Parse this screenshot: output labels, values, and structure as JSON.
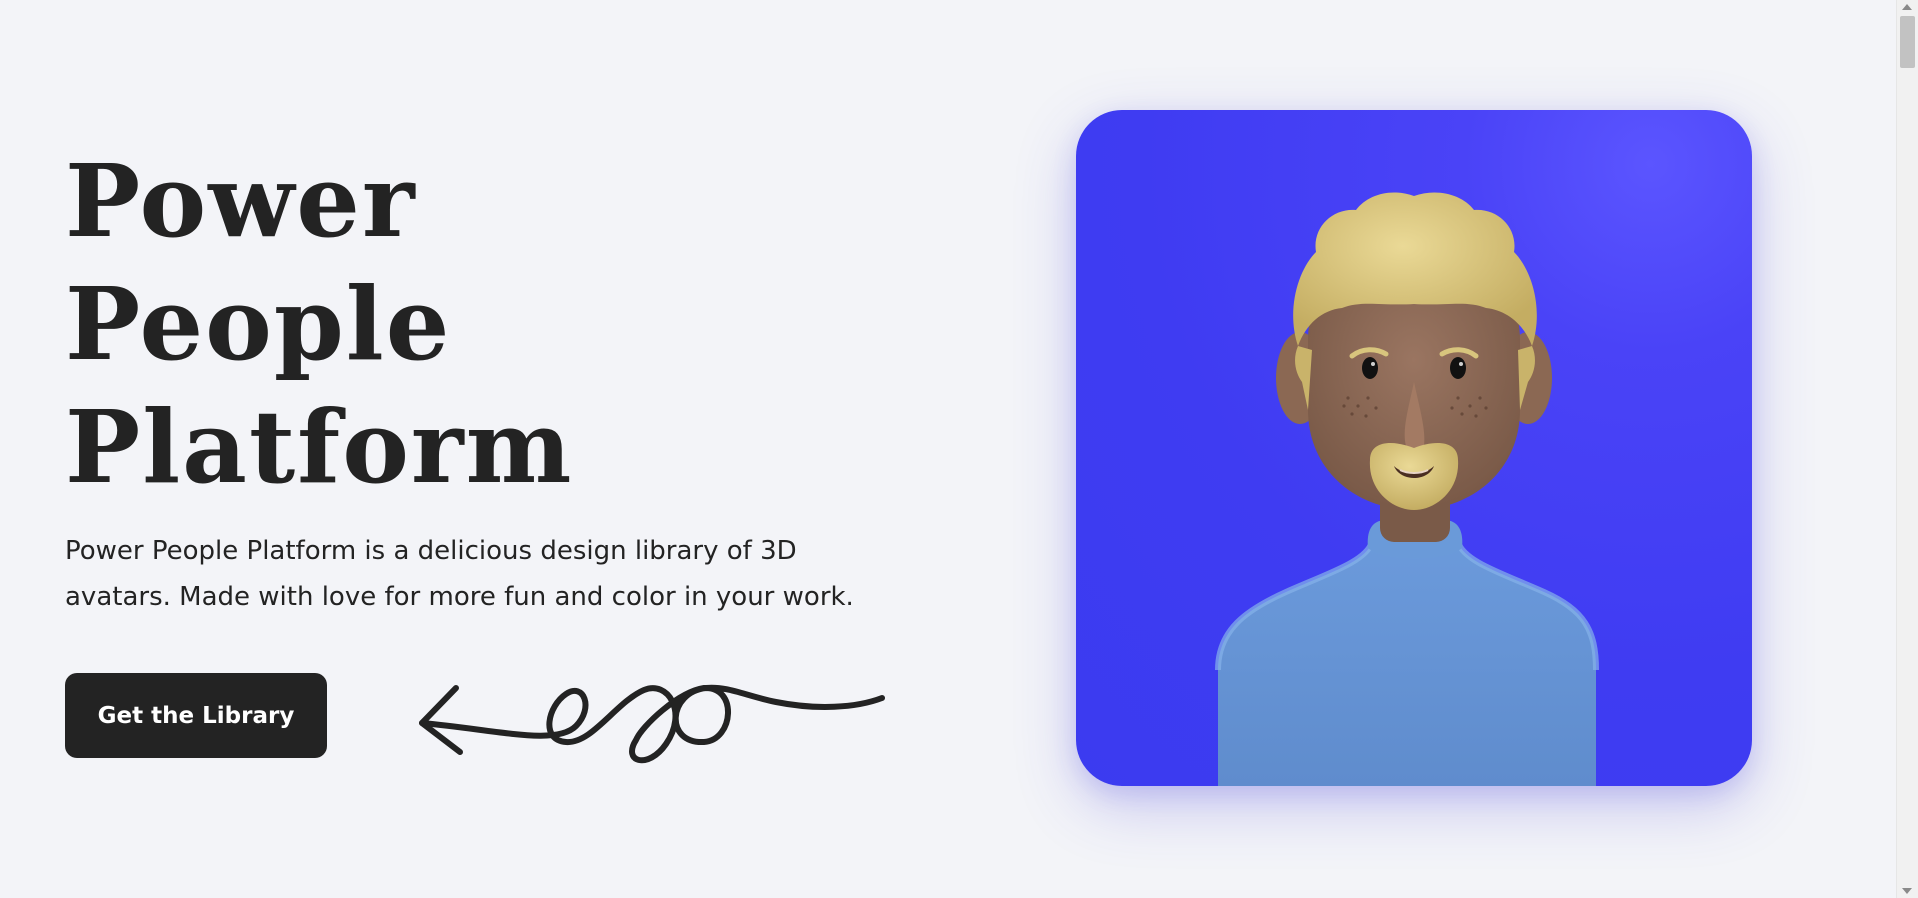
{
  "hero": {
    "title_lines": [
      "Power",
      "People",
      "Platform"
    ],
    "description": "Power People Platform is a delicious design library of 3D avatars. Made with love for more fun and color in your work.",
    "cta_label": "Get the Library"
  },
  "icons": {
    "squiggle_arrow": "squiggle-arrow-icon",
    "avatar": "avatar-illustration"
  },
  "colors": {
    "background": "#f3f4f8",
    "text": "#232323",
    "button_bg": "#232323",
    "button_text": "#ffffff",
    "card_blue": "#3f3cf2",
    "shirt": "#6594d3",
    "hair": "#d8c57d",
    "skin": "#8b6853"
  }
}
